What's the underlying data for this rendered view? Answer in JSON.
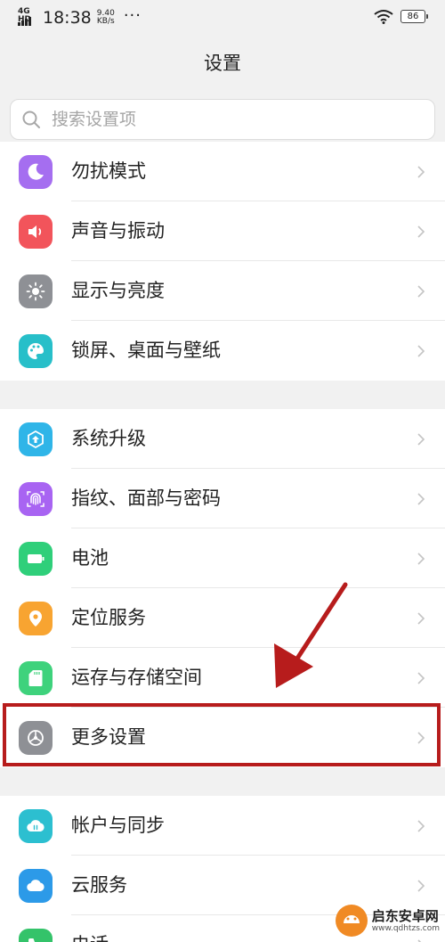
{
  "status_bar": {
    "network": "4G HD",
    "time": "18:38",
    "speed_value": "9.40",
    "speed_unit": "KB/s",
    "more": "···",
    "battery": "86"
  },
  "header": {
    "title": "设置"
  },
  "search": {
    "placeholder": "搜索设置项"
  },
  "groups": [
    {
      "items": [
        {
          "label": "勿扰模式",
          "icon": "moon-icon",
          "color": "#a56ef0"
        },
        {
          "label": "声音与振动",
          "icon": "speaker-icon",
          "color": "#f2545b"
        },
        {
          "label": "显示与亮度",
          "icon": "sun-icon",
          "color": "#8e9095"
        },
        {
          "label": "锁屏、桌面与壁纸",
          "icon": "palette-icon",
          "color": "#27bfc9"
        }
      ]
    },
    {
      "items": [
        {
          "label": "系统升级",
          "icon": "upgrade-icon",
          "color": "#2fb5e8"
        },
        {
          "label": "指纹、面部与密码",
          "icon": "fingerprint-icon",
          "color": "#a864f2"
        },
        {
          "label": "电池",
          "icon": "battery-icon",
          "color": "#2fcf7a"
        },
        {
          "label": "定位服务",
          "icon": "location-icon",
          "color": "#f8a431"
        },
        {
          "label": "运存与存储空间",
          "icon": "sdcard-icon",
          "color": "#3ed27c"
        },
        {
          "label": "更多设置",
          "icon": "gear-icon",
          "color": "#8e9095"
        }
      ]
    },
    {
      "items": [
        {
          "label": "帐户与同步",
          "icon": "cloud-sync-icon",
          "color": "#2cbfd0"
        },
        {
          "label": "云服务",
          "icon": "cloud-icon",
          "color": "#2c9ae8"
        },
        {
          "label": "电话",
          "icon": "phone-icon",
          "color": "#34c36a"
        }
      ]
    }
  ],
  "watermark": {
    "name": "启东安卓网",
    "url": "www.qdhtzs.com"
  },
  "colors": {
    "annotation": "#b71c1c",
    "background": "#f1f1f1"
  }
}
